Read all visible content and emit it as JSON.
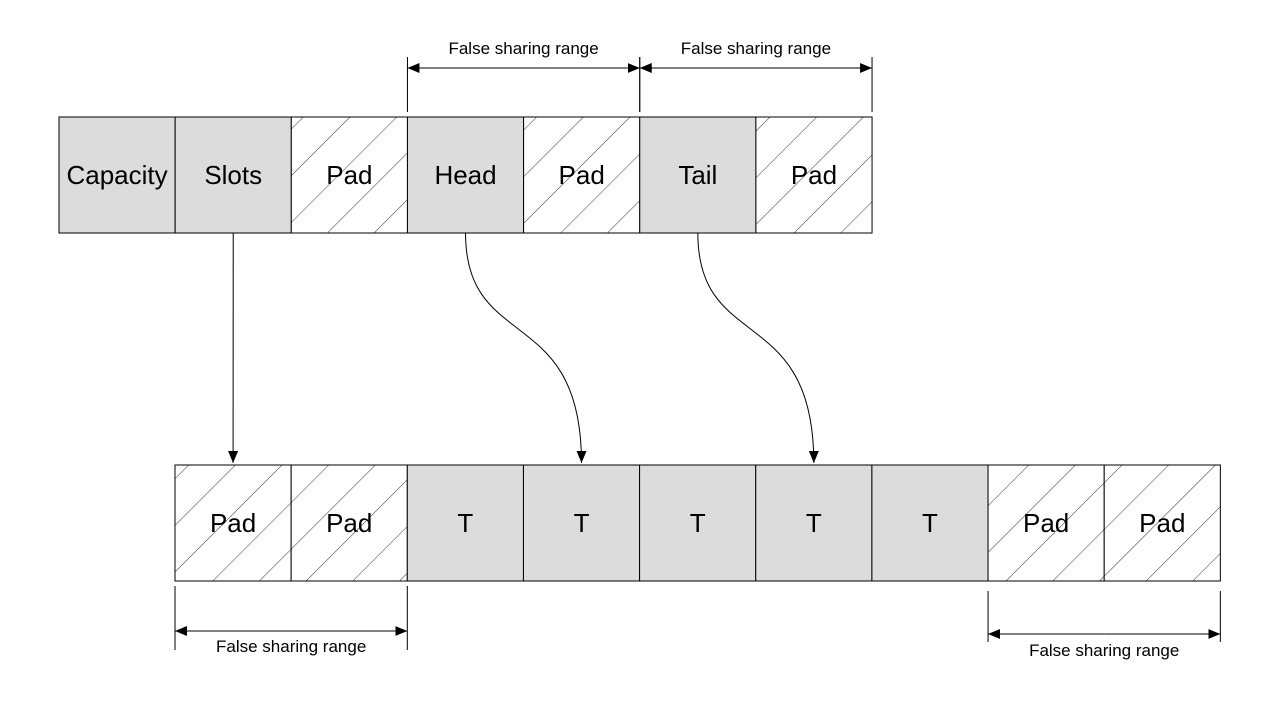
{
  "colors": {
    "filled": "#dcdcdc",
    "stroke": "#000000",
    "hatch": "#000000"
  },
  "top_row": {
    "cells": [
      {
        "label": "Capacity",
        "kind": "filled"
      },
      {
        "label": "Slots",
        "kind": "filled"
      },
      {
        "label": "Pad",
        "kind": "hatched"
      },
      {
        "label": "Head",
        "kind": "filled"
      },
      {
        "label": "Pad",
        "kind": "hatched"
      },
      {
        "label": "Tail",
        "kind": "filled"
      },
      {
        "label": "Pad",
        "kind": "hatched"
      }
    ]
  },
  "bottom_row": {
    "cells": [
      {
        "label": "Pad",
        "kind": "hatched"
      },
      {
        "label": "Pad",
        "kind": "hatched"
      },
      {
        "label": "T",
        "kind": "filled"
      },
      {
        "label": "T",
        "kind": "filled"
      },
      {
        "label": "T",
        "kind": "filled"
      },
      {
        "label": "T",
        "kind": "filled"
      },
      {
        "label": "T",
        "kind": "filled"
      },
      {
        "label": "Pad",
        "kind": "hatched"
      },
      {
        "label": "Pad",
        "kind": "hatched"
      }
    ]
  },
  "ranges": [
    {
      "label": "False sharing range",
      "row": "top",
      "from_cell": 3,
      "to_cell": 4
    },
    {
      "label": "False sharing range",
      "row": "top",
      "from_cell": 5,
      "to_cell": 6
    },
    {
      "label": "False sharing range",
      "row": "bottom",
      "from_cell": 0,
      "to_cell": 1
    },
    {
      "label": "False sharing range",
      "row": "bottom",
      "from_cell": 7,
      "to_cell": 8
    }
  ],
  "pointers": [
    {
      "from": "Slots",
      "from_cell": 1,
      "to_cell": 0,
      "style": "straight"
    },
    {
      "from": "Head",
      "from_cell": 3,
      "to_cell": 3,
      "style": "curved"
    },
    {
      "from": "Tail",
      "from_cell": 5,
      "to_cell": 5,
      "style": "curved"
    }
  ]
}
